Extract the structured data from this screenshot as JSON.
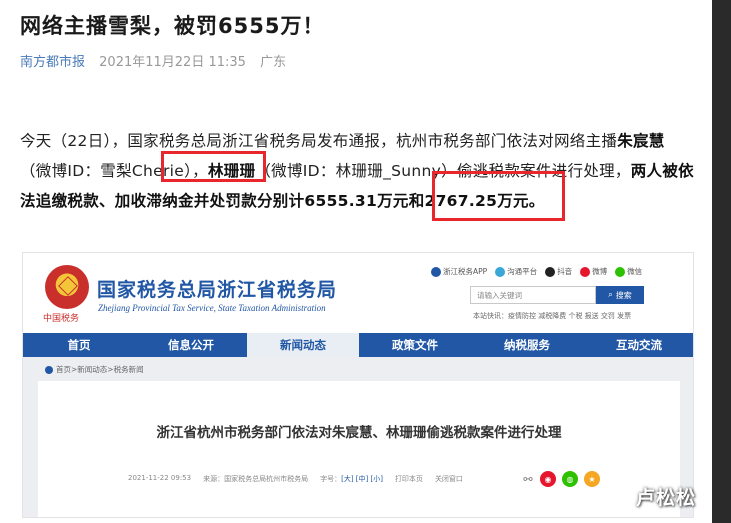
{
  "headline": "网络主播雪梨，被罚6555万！",
  "meta": {
    "source": "南方都市报",
    "datetime": "2021年11月22日 11:35",
    "region": "广东"
  },
  "paragraph": {
    "p1": "今天（22日），国家税务总局浙江省税务局发布通报，杭州市税务部门依法对网络主播",
    "name1": "朱宸慧",
    "p2": "（微博ID：雪梨Cherie），",
    "name2": "林珊珊",
    "p3": "（微博ID：林珊珊_Sunny）偷逃税款案件进行处理，",
    "bold_tail": "两人被依法追缴税款、加收滞纳金并处罚款分别计6555.31万元和2767.25万元。"
  },
  "colors": {
    "accent": "#2157a5",
    "highlight": "#e8262b",
    "source_link": "#4a7ab8"
  },
  "screenshot": {
    "org_cn": "国家税务总局浙江省税务局",
    "org_en": "Zhejiang Provincial Tax Service, State Taxation Administration",
    "links": [
      "浙江税务APP",
      "沟通平台",
      "抖音",
      "微博",
      "微信"
    ],
    "search_placeholder": "请输入关键词",
    "search_button": "搜索",
    "quick_links": "本站快讯：疫情防控 减税降费 个税 报送 交罚 发票",
    "nav": [
      "首页",
      "信息公开",
      "新闻动态",
      "政策文件",
      "纳税服务",
      "互动交流"
    ],
    "active_nav": "新闻动态",
    "breadcrumb": "首页>新闻动态>税务新闻",
    "article_title": "浙江省杭州市税务部门依法对朱宸慧、林珊珊偷逃税款案件进行处理",
    "article_meta": {
      "date": "2021-11-22 09:53",
      "source": "来源：国家税务总局杭州市税务局",
      "font_size_label": "字号：",
      "sizes": "[大] [中] [小]",
      "print": "打印本页",
      "close": "关闭窗口"
    }
  },
  "watermark": "卢松松"
}
